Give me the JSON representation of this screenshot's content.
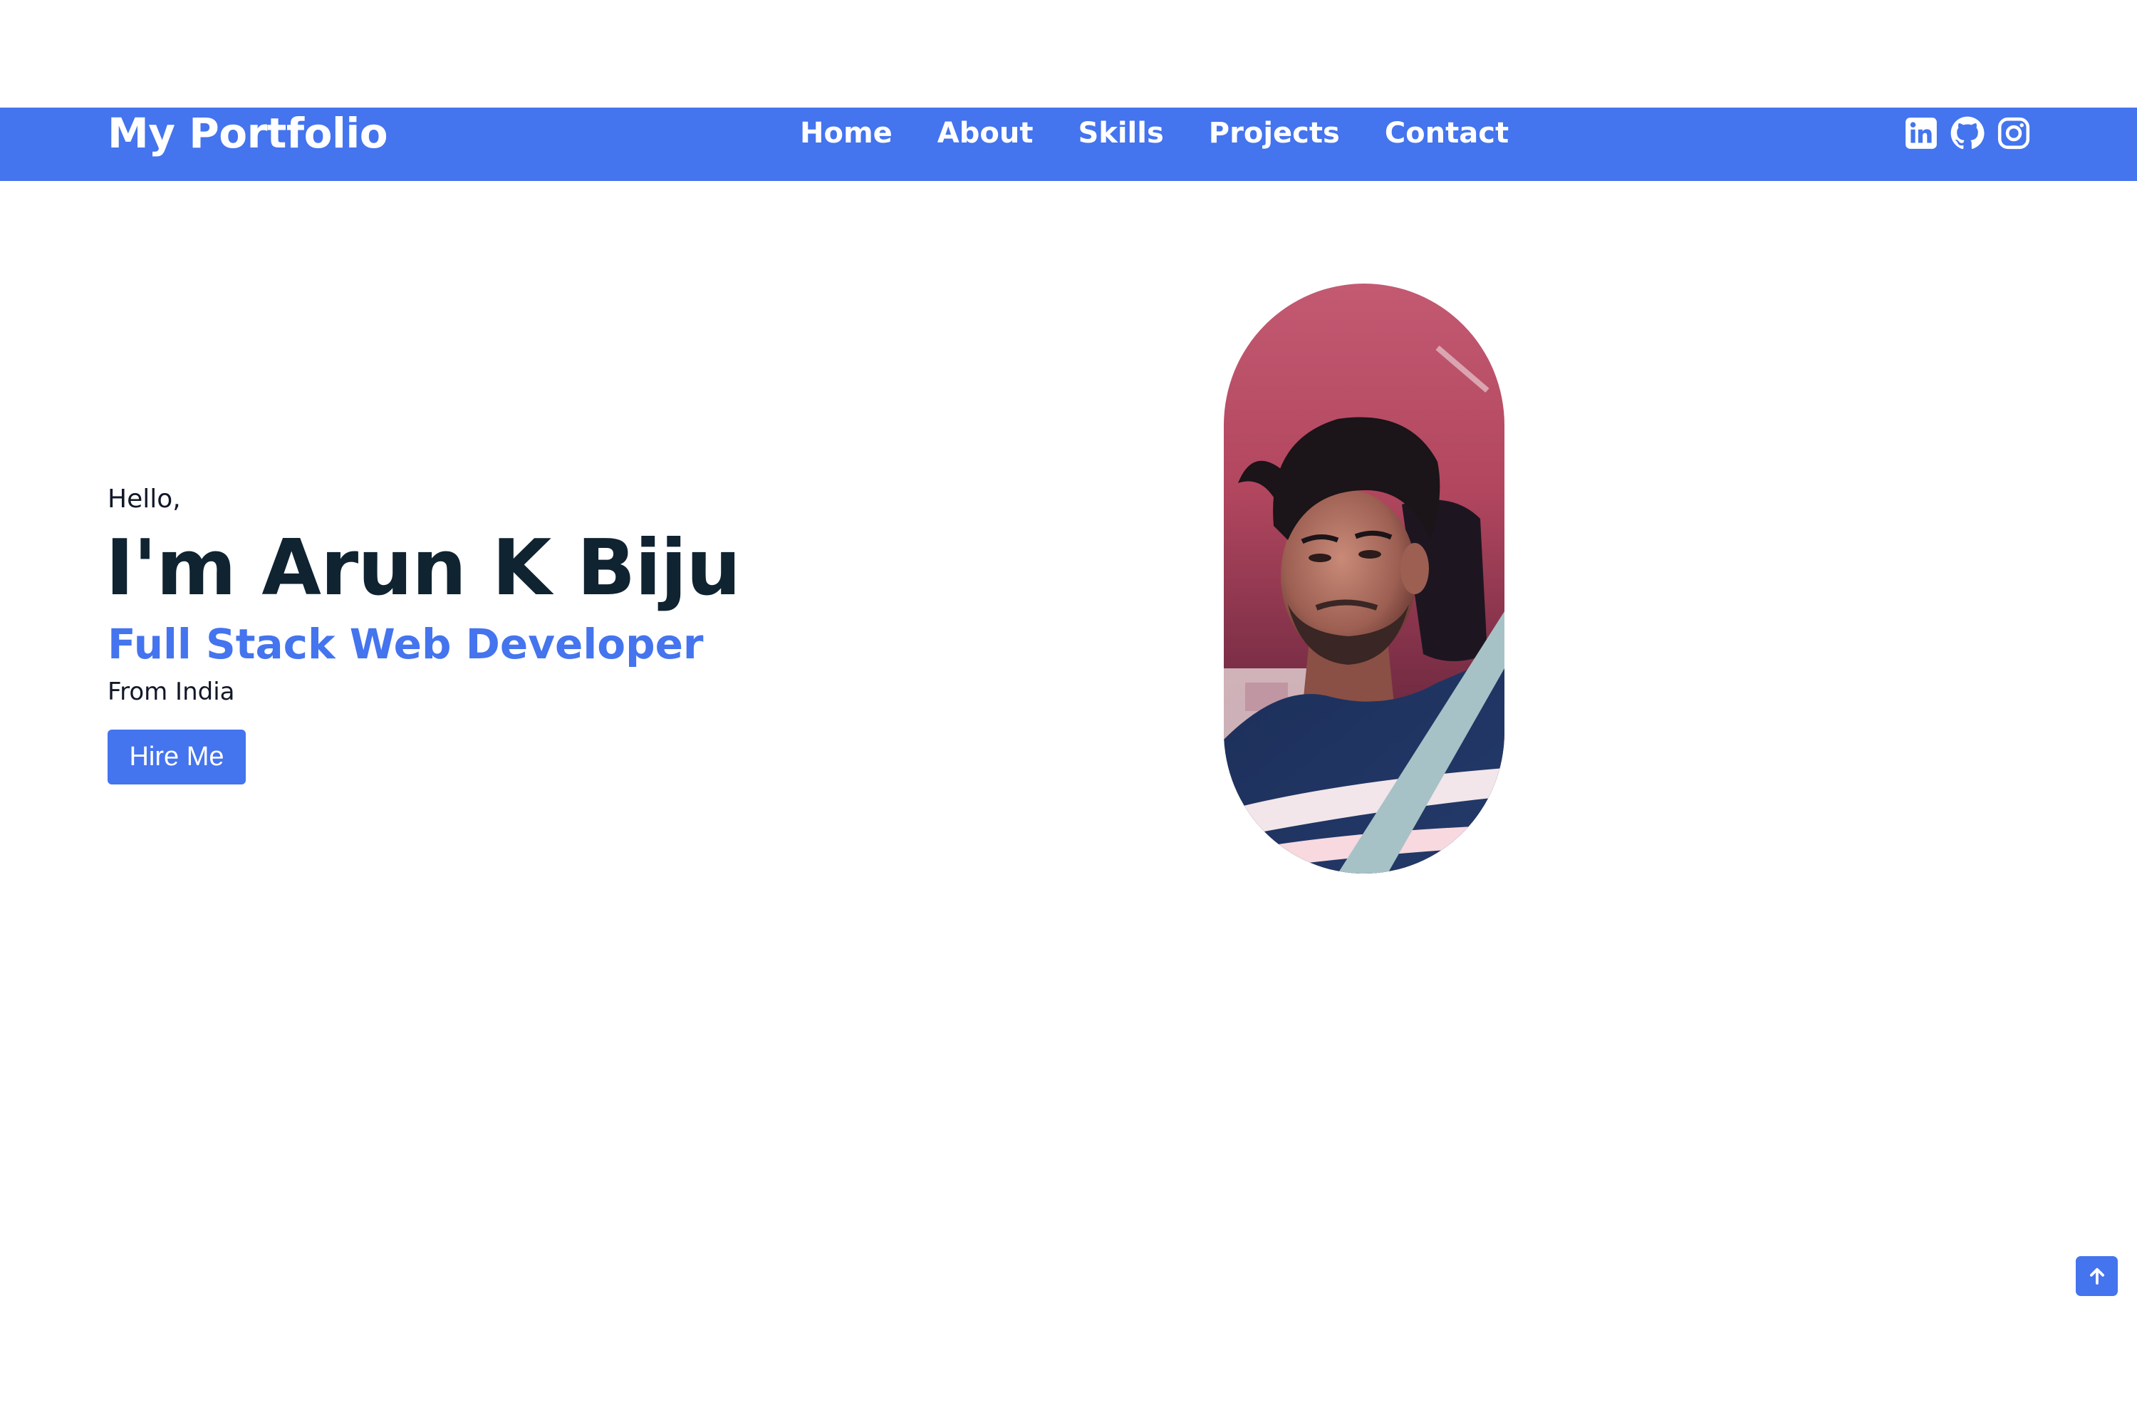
{
  "header": {
    "brand": "My Portfolio",
    "nav": [
      {
        "label": "Home"
      },
      {
        "label": "About"
      },
      {
        "label": "Skills"
      },
      {
        "label": "Projects"
      },
      {
        "label": "Contact"
      }
    ],
    "social_icons": [
      "linkedin-icon",
      "github-icon",
      "instagram-icon"
    ]
  },
  "hero": {
    "greeting": "Hello,",
    "name": "I'm Arun K Biju",
    "role": "Full Stack Web Developer",
    "location": "From India",
    "cta_label": "Hire Me",
    "photo": "profile-photo"
  },
  "back_to_top_icon": "arrow-up-icon",
  "colors": {
    "accent": "#4474ee",
    "heading": "#0f2331",
    "text": "#111827",
    "background": "#ffffff"
  }
}
